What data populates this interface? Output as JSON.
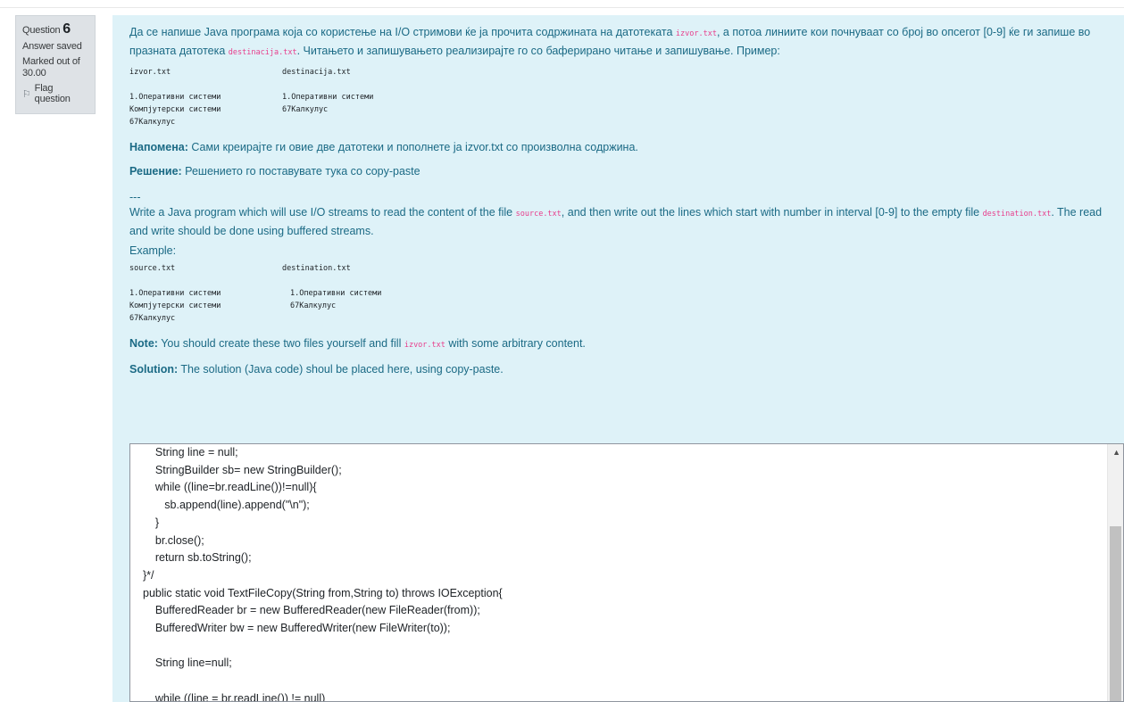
{
  "info": {
    "question_label": "Question",
    "question_number": "6",
    "status": "Answer saved",
    "marked": "Marked out of 30.00",
    "flag_label": "Flag question"
  },
  "question": {
    "mk_intro_1": "Да се напише Java програма која со користење на I/O стримови ќе ја прочита содржината на датотеката ",
    "mk_file_src": "izvor.txt",
    "mk_intro_2": ", а потоа линиите кои почнуваат со број во опсегот [0-9] ќе ги запише во празната датотека ",
    "mk_file_dst": "destinacija.txt",
    "mk_intro_3": ". Читањето и запишувањето реализирајте го со баферирано читање и запишување. Пример:",
    "mk_head_left": "izvor.txt",
    "mk_head_right": "destinacija.txt",
    "mk_rows": [
      {
        "left": "1.Оперативни системи",
        "right": "1.Оперативни системи"
      },
      {
        "left": "Компјутерски системи",
        "right": "67Калкулус"
      },
      {
        "left": "67Калкулус",
        "right": ""
      }
    ],
    "mk_note_label": "Напомена:",
    "mk_note_text": " Сами креирајте ги овие две датотеки и пополнете ја izvor.txt со произволна содржина.",
    "mk_sol_label": "Решение:",
    "mk_sol_text": " Решението го поставувате тука со copy-paste",
    "separator": "---",
    "en_intro_1": "Write a Java program which will use I/O streams to read the content of the file ",
    "en_file_src": "source.txt",
    "en_intro_2": ", and then write out the lines which start with number in interval [0-9] to the empty file ",
    "en_file_dst": "destination.txt",
    "en_intro_3": ". The read and write should be done using buffered streams.",
    "en_example": "Example:",
    "en_head_left": "source.txt",
    "en_head_right": "destination.txt",
    "en_rows": [
      {
        "left": "1.Оперативни системи",
        "right": "1.Оперативни системи"
      },
      {
        "left": "Компјутерски системи",
        "right": "67Калкулус"
      },
      {
        "left": "67Калкулус",
        "right": ""
      }
    ],
    "en_note_label": "Note:",
    "en_note_text_1": " You should create these two files yourself and fill ",
    "en_note_file": "izvor.txt",
    "en_note_text_2": " with some arbitrary content.",
    "en_sol_label": "Solution:",
    "en_sol_text": " The solution (Java code) shoul be placed here, using copy-paste."
  },
  "answer_lines": [
    "    String line = null;",
    "    StringBuilder sb= new StringBuilder();",
    "    while ((line=br.readLine())!=null){",
    "       sb.append(line).append(\"\\n\");",
    "    }",
    "    br.close();",
    "    return sb.toString();",
    "}*/",
    "public static void TextFileCopy(String from,String to) throws IOException{",
    "    BufferedReader br = new BufferedReader(new FileReader(from));",
    "    BufferedWriter bw = new BufferedWriter(new FileWriter(to));",
    "",
    "    String line=null;",
    "",
    "    while ((line = br.readLine()) != null)"
  ]
}
